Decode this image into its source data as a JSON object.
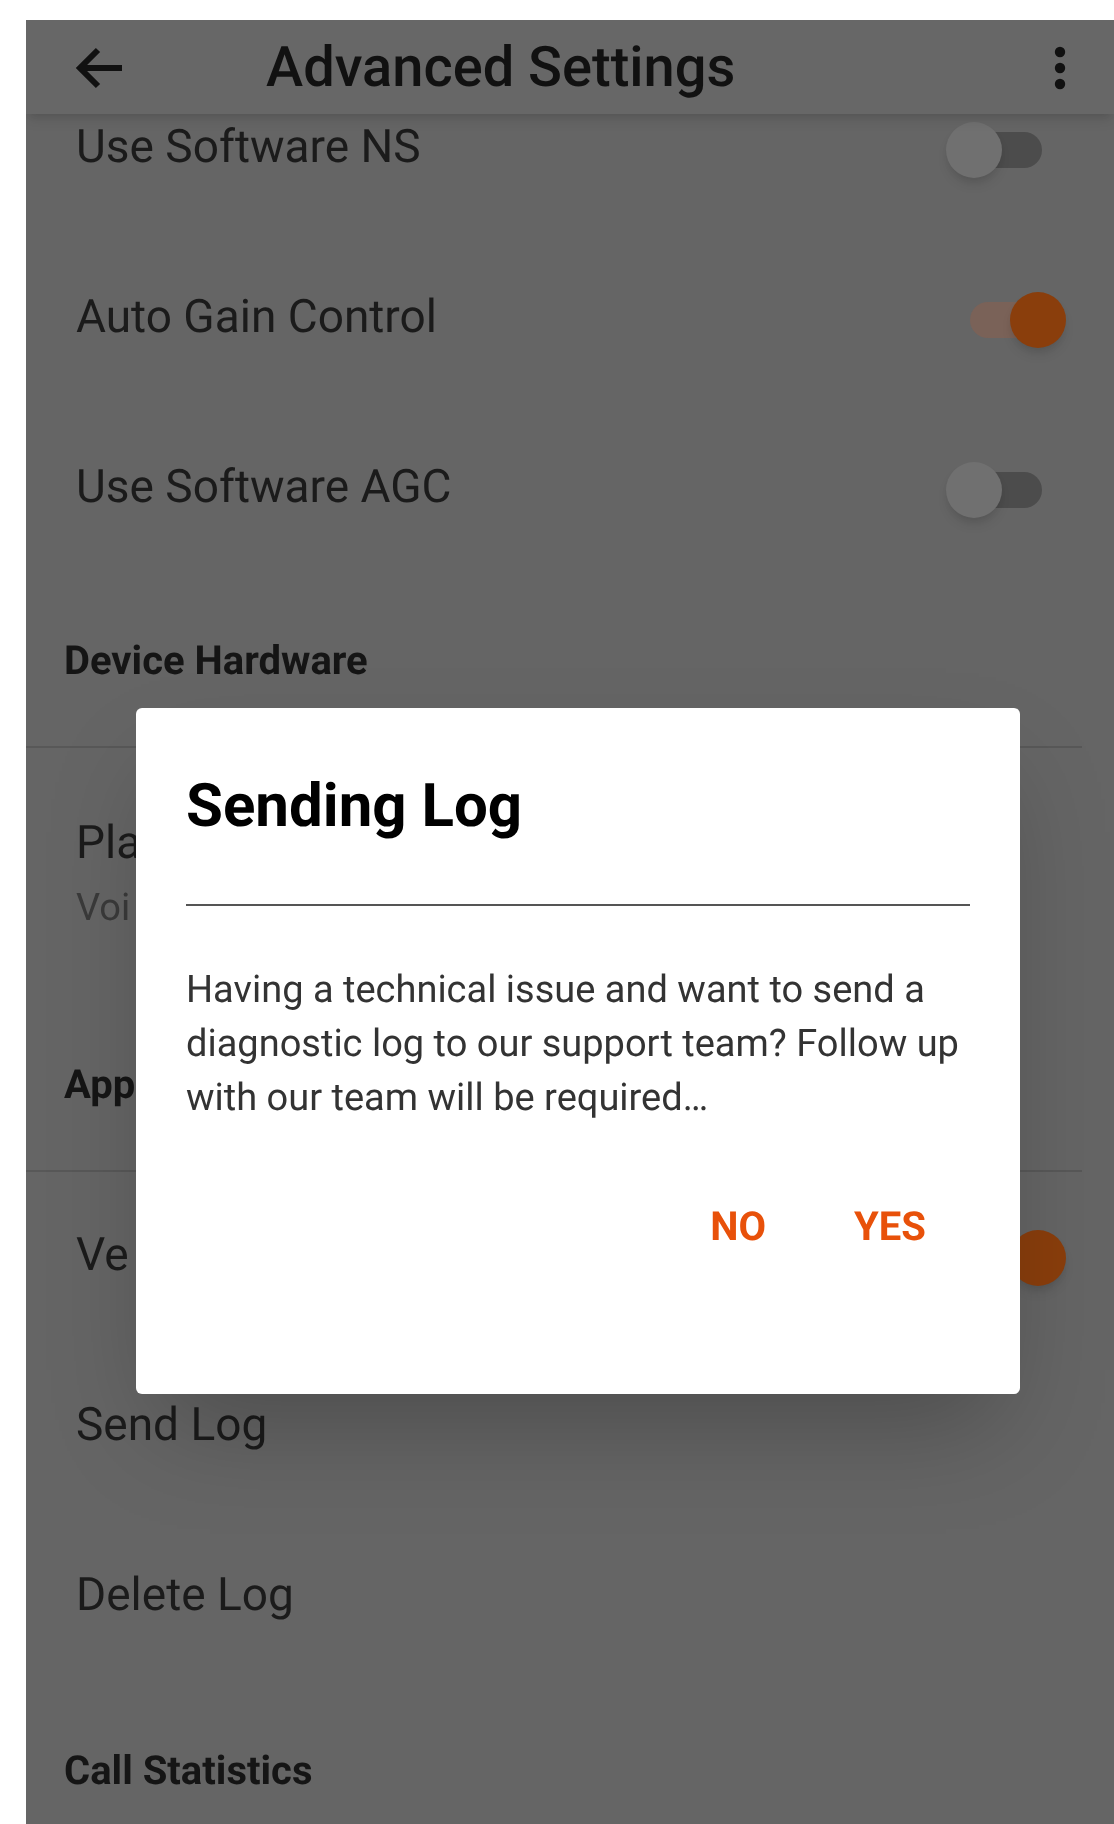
{
  "app_bar": {
    "title": "Advanced Settings"
  },
  "sections": [
    {
      "items": [
        {
          "kind": "switch",
          "label": "Use Software NS",
          "on": false
        },
        {
          "kind": "switch",
          "label": "Auto Gain Control",
          "on": true
        },
        {
          "kind": "switch",
          "label": "Use Software AGC",
          "on": false
        }
      ]
    },
    {
      "heading": "Device Hardware",
      "items": [
        {
          "kind": "option",
          "label": "Pla",
          "summary": "Voi"
        }
      ]
    },
    {
      "heading": "App",
      "items": [
        {
          "kind": "switch",
          "label": "Ve",
          "on": true
        },
        {
          "kind": "action",
          "label": "Send Log"
        },
        {
          "kind": "action",
          "label": "Delete Log"
        }
      ]
    },
    {
      "heading": "Call Statistics"
    }
  ],
  "dialog": {
    "title": "Sending Log",
    "message": "Having a technical issue and want to send a diagnostic log to our support team? Follow up with our team will be required…",
    "buttons": [
      "NO",
      "YES"
    ]
  }
}
